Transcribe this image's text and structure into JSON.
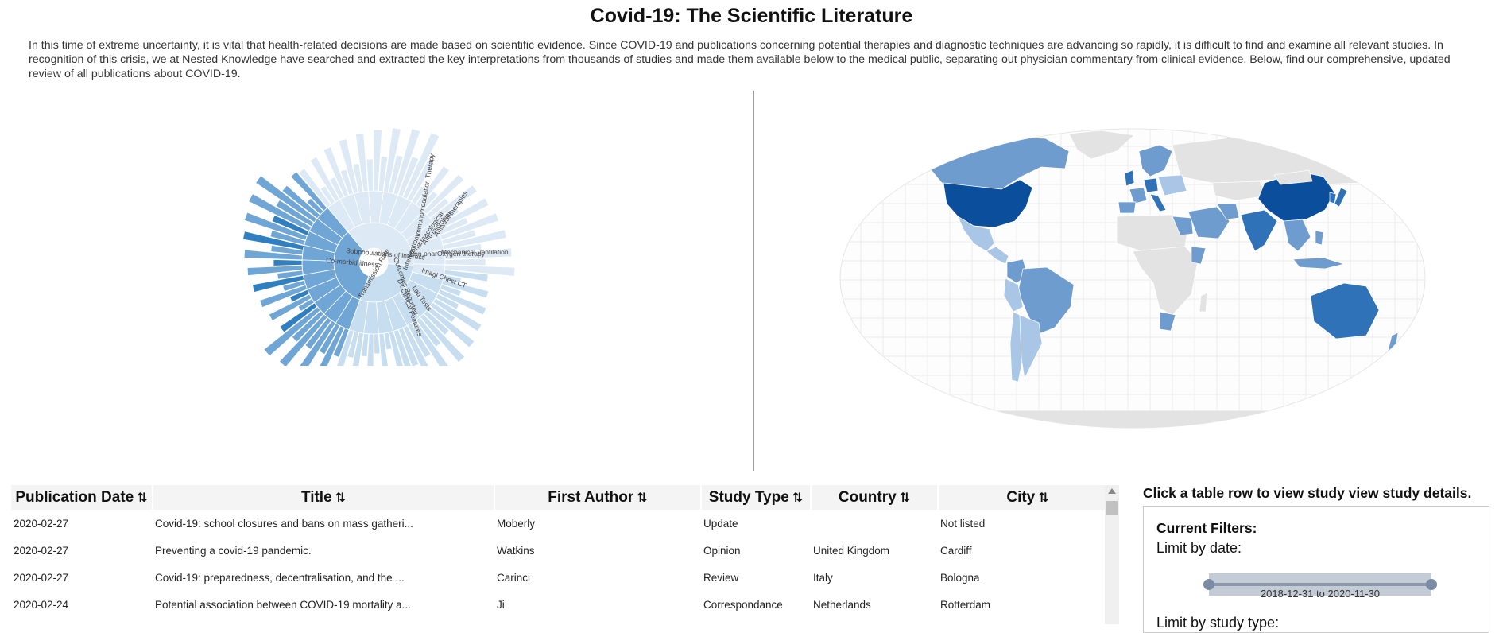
{
  "page": {
    "title": "Covid-19: The Scientific Literature",
    "intro": "In this time of extreme uncertainty, it is vital that health-related decisions are made based on scientific evidence. Since COVID-19 and publications concerning potential therapies and diagnostic techniques are advancing so rapidly, it is difficult to find and examine all relevant studies. In recognition of this crisis, we at Nested Knowledge have searched and extracted the key interpretations from thousands of studies and made them available below to the medical public, separating out physician commentary from clinical evidence. Below, find our comprehensive, updated review of all publications about COVID-19."
  },
  "sunburst": {
    "labels": [
      "Immunomodulation Therapy",
      "Pharmacological",
      "Anti microbial",
      "Antiviral therapies",
      "Intervention",
      "Outcomes Reported",
      "Subpopulations of interest",
      "Co-morbid illness",
      "Non pharOxygen therapy",
      "Mechanical Ventilation",
      "Imagi Chest CT",
      "Lab Tests",
      "Dx Clinical Features",
      "Transmission Rate"
    ],
    "colors": {
      "dark": "#2f7fc1",
      "mid": "#6fa6d6",
      "light": "#c7ddf0",
      "pale": "#dde9f5"
    }
  },
  "map": {
    "colors": {
      "darkest": "#0b4f9c",
      "dark": "#2f72b7",
      "mid": "#6e9ccf",
      "light": "#a9c6e6",
      "none": "#e3e3e3",
      "grid": "#ececec"
    }
  },
  "table": {
    "columns": [
      "Publication Date",
      "Title",
      "First Author",
      "Study Type",
      "Country",
      "City"
    ],
    "sort_icon": "⇅",
    "rows": [
      [
        "2020-02-27",
        "Covid-19: school closures and bans on mass gatheri...",
        "Moberly",
        "Update",
        "",
        "Not listed"
      ],
      [
        "2020-02-27",
        "Preventing a covid-19 pandemic.",
        "Watkins",
        "Opinion",
        "United Kingdom",
        "Cardiff"
      ],
      [
        "2020-02-27",
        "Covid-19: preparedness, decentralisation, and the ...",
        "Carinci",
        "Review",
        "Italy",
        "Bologna"
      ],
      [
        "2020-02-24",
        "Potential association between COVID-19 mortality a...",
        "Ji",
        "Correspondance",
        "Netherlands",
        "Rotterdam"
      ]
    ]
  },
  "sidebar": {
    "title": "Click a table row to view study view study details.",
    "filters_heading": "Current Filters:",
    "limit_date_label": "Limit by date:",
    "date_range": "2018-12-31 to 2020-11-30",
    "limit_type_label": "Limit by study type:"
  }
}
